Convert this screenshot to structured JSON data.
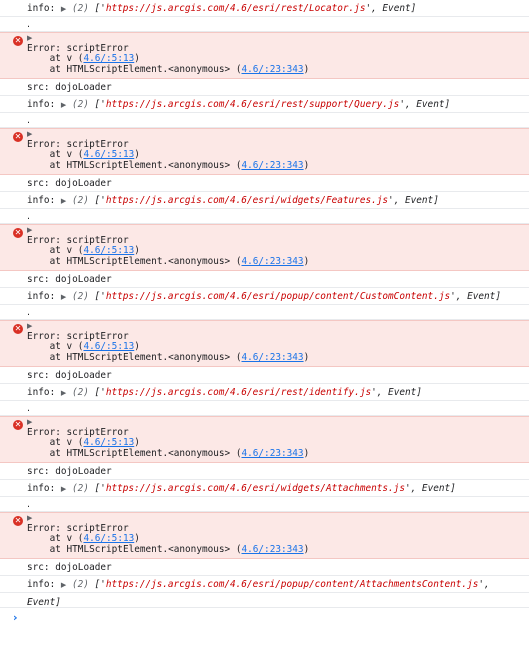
{
  "log": {
    "info_label": "info:",
    "src_label": "src:",
    "dot": ".",
    "error_title": "Error: scriptError",
    "at_v_prefix": "    at v (",
    "at_v_link": "4.6/:5:13",
    "at_script_prefix": "    at HTMLScriptElement.<anonymous> (",
    "at_script_link": "4.6/:23:343",
    "close_paren": ")",
    "src_value": "dojoLoader",
    "count": "(2)",
    "open_bracket": "['",
    "mid_sep": "', ",
    "event": "Event",
    "close_bracket": "]",
    "entries": [
      "https://js.arcgis.com/4.6/esri/rest/Locator.js",
      "https://js.arcgis.com/4.6/esri/rest/support/Query.js",
      "https://js.arcgis.com/4.6/esri/widgets/Features.js",
      "https://js.arcgis.com/4.6/esri/popup/content/CustomContent.js",
      "https://js.arcgis.com/4.6/esri/rest/identify.js",
      "https://js.arcgis.com/4.6/esri/widgets/Attachments.js",
      "https://js.arcgis.com/4.6/esri/popup/content/AttachmentsContent.js"
    ]
  },
  "prompt": {
    "glyph": "›"
  },
  "colors": {
    "error_bg": "#fce8e6",
    "link": "#1a73e8",
    "string": "#c80000"
  }
}
